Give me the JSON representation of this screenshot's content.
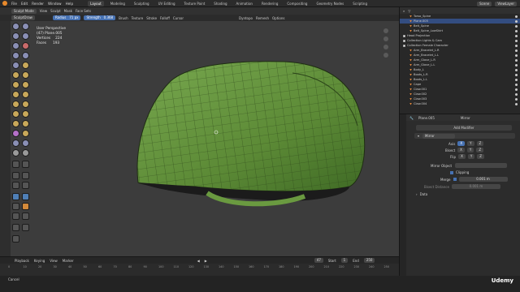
{
  "menubar": {
    "items": [
      "File",
      "Edit",
      "Render",
      "Window",
      "Help"
    ],
    "workspaces": [
      "Layout",
      "Modeling",
      "Sculpting",
      "UV Editing",
      "Texture Paint",
      "Shading",
      "Animation",
      "Rendering",
      "Compositing",
      "Geometry Nodes",
      "Scripting"
    ],
    "active_workspace": "Layout",
    "scene_label": "Scene",
    "viewlayer_label": "ViewLayer"
  },
  "viewport_header": {
    "mode": "Sculpt Mode",
    "menus": [
      "View",
      "Sculpt",
      "Mask",
      "Face Sets"
    ],
    "brush_name": "SculptDraw",
    "radius_label": "Radius",
    "radius_value": "71 px",
    "strength_label": "Strength",
    "strength_value": "0.368",
    "brush": "Brush",
    "texture": "Texture",
    "stroke": "Stroke",
    "falloff": "Falloff",
    "cursor": "Cursor",
    "dyntopo": "Dyntopo",
    "remesh": "Remesh",
    "options": "Options"
  },
  "overlay": {
    "view_name": "User Perspective",
    "object_name": "(47) Plane.005",
    "vertices_label": "Vertices",
    "vertices_value": "224",
    "faces_label": "Faces",
    "faces_value": "193"
  },
  "outliner": {
    "items": [
      {
        "name": "Torso_Spine",
        "selected": false,
        "icon": "mesh"
      },
      {
        "name": "Plane.005",
        "selected": true,
        "icon": "mesh"
      },
      {
        "name": "Belt_Spine",
        "selected": false,
        "icon": "mesh"
      },
      {
        "name": "Belt_Spine_LowSkirt",
        "selected": false,
        "icon": "mesh"
      },
      {
        "name": "Head Projection",
        "selected": false,
        "icon": "collection"
      },
      {
        "name": "Collection Lights & Cam",
        "selected": false,
        "icon": "collection"
      },
      {
        "name": "Collection Female Character",
        "selected": false,
        "icon": "collection"
      },
      {
        "name": "Arm_Bracelet_L.R",
        "selected": false,
        "icon": "mesh"
      },
      {
        "name": "Arm_Bracelet_L.L",
        "selected": false,
        "icon": "mesh"
      },
      {
        "name": "Arm_Glove_L.R",
        "selected": false,
        "icon": "mesh"
      },
      {
        "name": "Arm_Glove_L.L",
        "selected": false,
        "icon": "mesh"
      },
      {
        "name": "Body_L",
        "selected": false,
        "icon": "mesh"
      },
      {
        "name": "Boots_L.R",
        "selected": false,
        "icon": "mesh"
      },
      {
        "name": "Boots_L.L",
        "selected": false,
        "icon": "mesh"
      },
      {
        "name": "Cape",
        "selected": false,
        "icon": "mesh"
      },
      {
        "name": "Claw.001",
        "selected": false,
        "icon": "mesh"
      },
      {
        "name": "Claw.002",
        "selected": false,
        "icon": "mesh"
      },
      {
        "name": "Claw.003",
        "selected": false,
        "icon": "mesh"
      },
      {
        "name": "Claw.004",
        "selected": false,
        "icon": "mesh"
      }
    ]
  },
  "properties": {
    "object_name": "Plane.005",
    "modifier_tab": "Mirror",
    "add_modifier": "Add Modifier",
    "modifier_name": "Mirror",
    "axis_label": "Axis",
    "bisect_label": "Bisect",
    "flip_label": "Flip",
    "axes": [
      "X",
      "Y",
      "Z"
    ],
    "mirror_object_label": "Mirror Object",
    "clipping_label": "Clipping",
    "merge_label": "Merge",
    "merge_value": "0.001 m",
    "bisect_distance_label": "Bisect Distance",
    "bisect_distance_value": "0.001 m",
    "data_section": "Data"
  },
  "timeline": {
    "menus": [
      "Playback",
      "Keying",
      "View",
      "Marker"
    ],
    "current_frame": "47",
    "start_label": "Start",
    "start_value": "1",
    "end_label": "End",
    "end_value": "250",
    "ticks": [
      "0",
      "10",
      "20",
      "30",
      "40",
      "50",
      "60",
      "70",
      "80",
      "90",
      "100",
      "110",
      "120",
      "130",
      "140",
      "150",
      "160",
      "170",
      "180",
      "190",
      "200",
      "210",
      "220",
      "230",
      "240",
      "250"
    ]
  },
  "statusbar": {
    "left_text": "Cancel",
    "watermark": "Udemy"
  },
  "colors": {
    "mesh_green": "#5f8f3a",
    "accent_blue": "#4772b3",
    "selection_blue": "#334d80",
    "orange": "#e8892b"
  }
}
